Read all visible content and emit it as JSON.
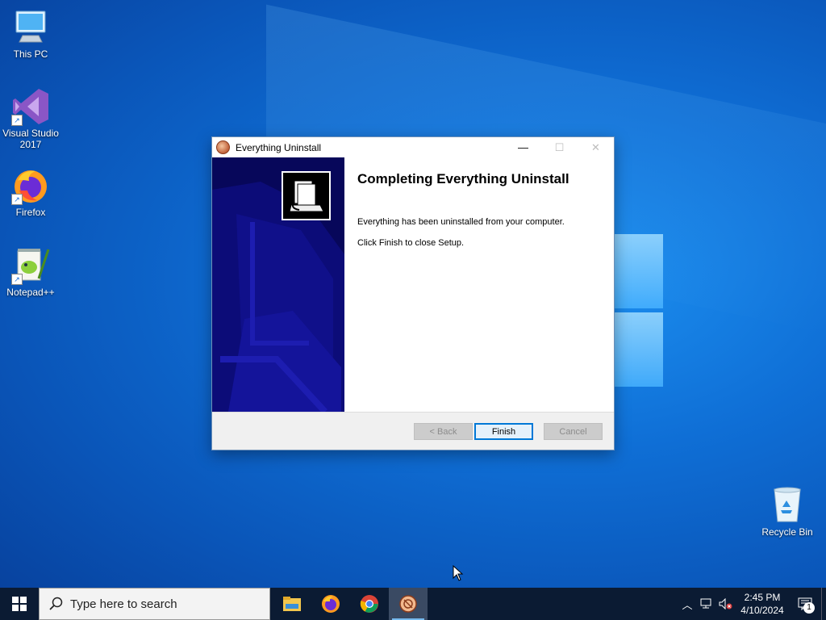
{
  "desktop": {
    "icons": [
      {
        "label": "This PC"
      },
      {
        "label": "Visual Studio 2017"
      },
      {
        "label": "Firefox"
      },
      {
        "label": "Notepad++"
      }
    ],
    "recycle_bin": {
      "label": "Recycle Bin"
    }
  },
  "dialog": {
    "title": "Everything Uninstall",
    "heading": "Completing Everything Uninstall",
    "message1": "Everything has been uninstalled from your computer.",
    "message2": "Click Finish to close Setup.",
    "buttons": {
      "back": "< Back",
      "finish": "Finish",
      "cancel": "Cancel"
    },
    "controls": {
      "minimize": "—",
      "maximize": "☐",
      "close": "✕"
    }
  },
  "taskbar": {
    "search_placeholder": "Type here to search",
    "apps": [
      "file-explorer",
      "firefox",
      "chrome",
      "everything-uninstall"
    ],
    "clock": {
      "time": "2:45 PM",
      "date": "4/10/2024"
    },
    "notification_count": "1"
  },
  "colors": {
    "accent": "#0078d7",
    "taskbar": "#0b1b33",
    "sidebar": "#0a0a5e"
  }
}
